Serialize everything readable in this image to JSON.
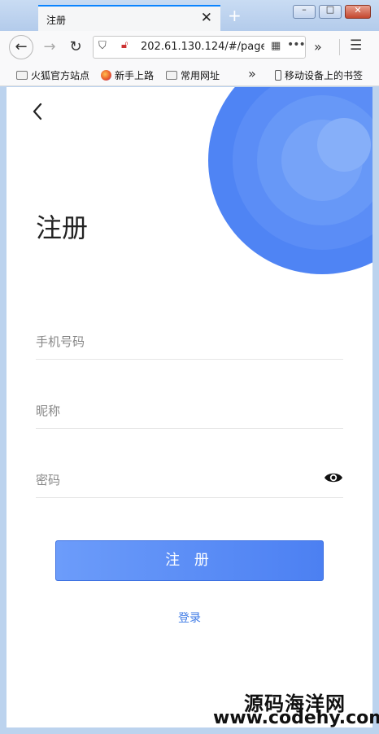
{
  "browser": {
    "tab_title": "注册",
    "tab_close": "✕",
    "new_tab": "+",
    "url": "202.61.130.124/#/page",
    "overflow": "»",
    "menu": "☰",
    "window_controls": {
      "minimize": "–",
      "maximize": "□",
      "close": "✕"
    }
  },
  "bookmarks": {
    "items": [
      "火狐官方站点",
      "新手上路",
      "常用网址"
    ],
    "overflow": "»",
    "mobile": "移动设备上的书签"
  },
  "page": {
    "title": "注册",
    "fields": {
      "phone_placeholder": "手机号码",
      "nickname_placeholder": "昵称",
      "password_placeholder": "密码"
    },
    "submit_label": "注 册",
    "login_link": "登录",
    "accent_color": "#4f84f4"
  },
  "watermark": {
    "line1": "源码海洋网",
    "line2": "www.codehy.com"
  }
}
